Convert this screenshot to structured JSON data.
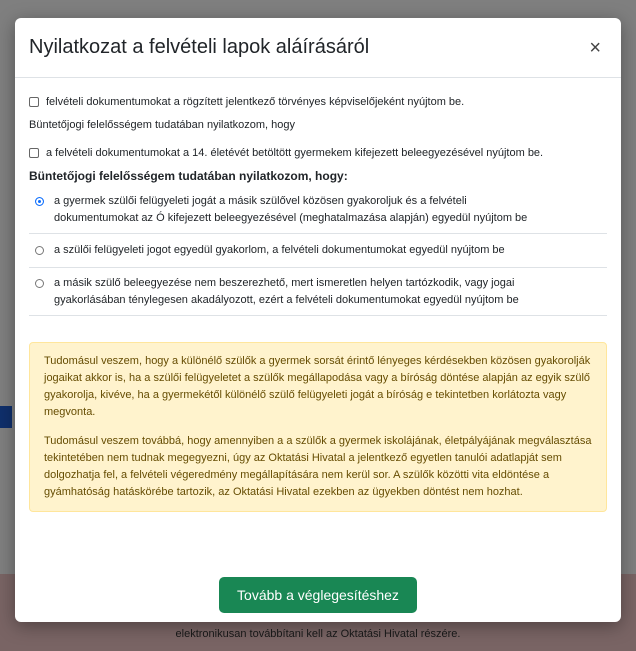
{
  "modal": {
    "title": "Nyilatkozat a felvételi lapok aláírásáról",
    "close_symbol": "×",
    "check_representative": "felvételi dokumentumokat a rögzített jelentkező törvényes képviselőjeként nyújtom be.",
    "criminal_statement_plain": "Büntetőjogi felelősségem tudatában nyilatkozom, hogy",
    "check_consent14": "a felvételi dokumentumokat a 14. életévét betöltött gyermekem kifejezett beleegyezésével nyújtom be.",
    "criminal_statement_bold": "Büntetőjogi felelősségem tudatában nyilatkozom, hogy:",
    "options": [
      {
        "line1": "a gyermek szülői felügyeleti jogát a másik szülővel közösen gyakoroljuk és a felvételi",
        "line2": "dokumentumokat az Ó kifejezett beleegyezésével (meghatalmazása alapján) egyedül nyújtom be",
        "selected": true
      },
      {
        "line1": "a szülői felügyeleti jogot egyedül gyakorlom, a felvételi dokumentumokat egyedül nyújtom be",
        "line2": "",
        "selected": false
      },
      {
        "line1": "a másik szülő beleegyezése nem beszerezhető, mert ismeretlen helyen tartózkodik, vagy jogai",
        "line2": "gyakorlásában ténylegesen akadályozott, ezért a felvételi dokumentumokat egyedül nyújtom be",
        "selected": false
      }
    ],
    "warning_p1": "Tudomásul veszem, hogy a különélő szülők a gyermek sorsát érintő lényeges kérdésekben közösen gyakorolják jogaikat akkor is, ha a szülői felügyeletet a szülők megállapodása vagy a bíróság döntése alapján az egyik szülő gyakorolja, kivéve, ha a gyermekétől különélő szülő felügyeleti jogát a bíróság e tekintetben korlátozta vagy megvonta.",
    "warning_p2": "Tudomásul veszem továbbá, hogy amennyiben a a szülők a gyermek iskolájának, életpályájának megválasztása tekintetében nem tudnak megegyezni, úgy az Oktatási Hivatal a jelentkező egyetlen tanulói adatlapját sem dolgozhatja fel, a felvételi végeredmény megállapítására nem kerül sor. A szülők közötti vita eldöntése a gyámhatóság hatáskörébe tartozik, az Oktatási Hivatal ezekben az ügyekben döntést nem hozhat.",
    "continue_button": "Tovább a véglegesítéshez"
  },
  "background": {
    "footer_line": "elektronikusan továbbítani kell az Oktatási Hivatal részére."
  },
  "colors": {
    "primary_green": "#198754",
    "radio_blue": "#0d6efd",
    "warning_bg": "#fff3cd",
    "warning_text": "#664d03"
  }
}
